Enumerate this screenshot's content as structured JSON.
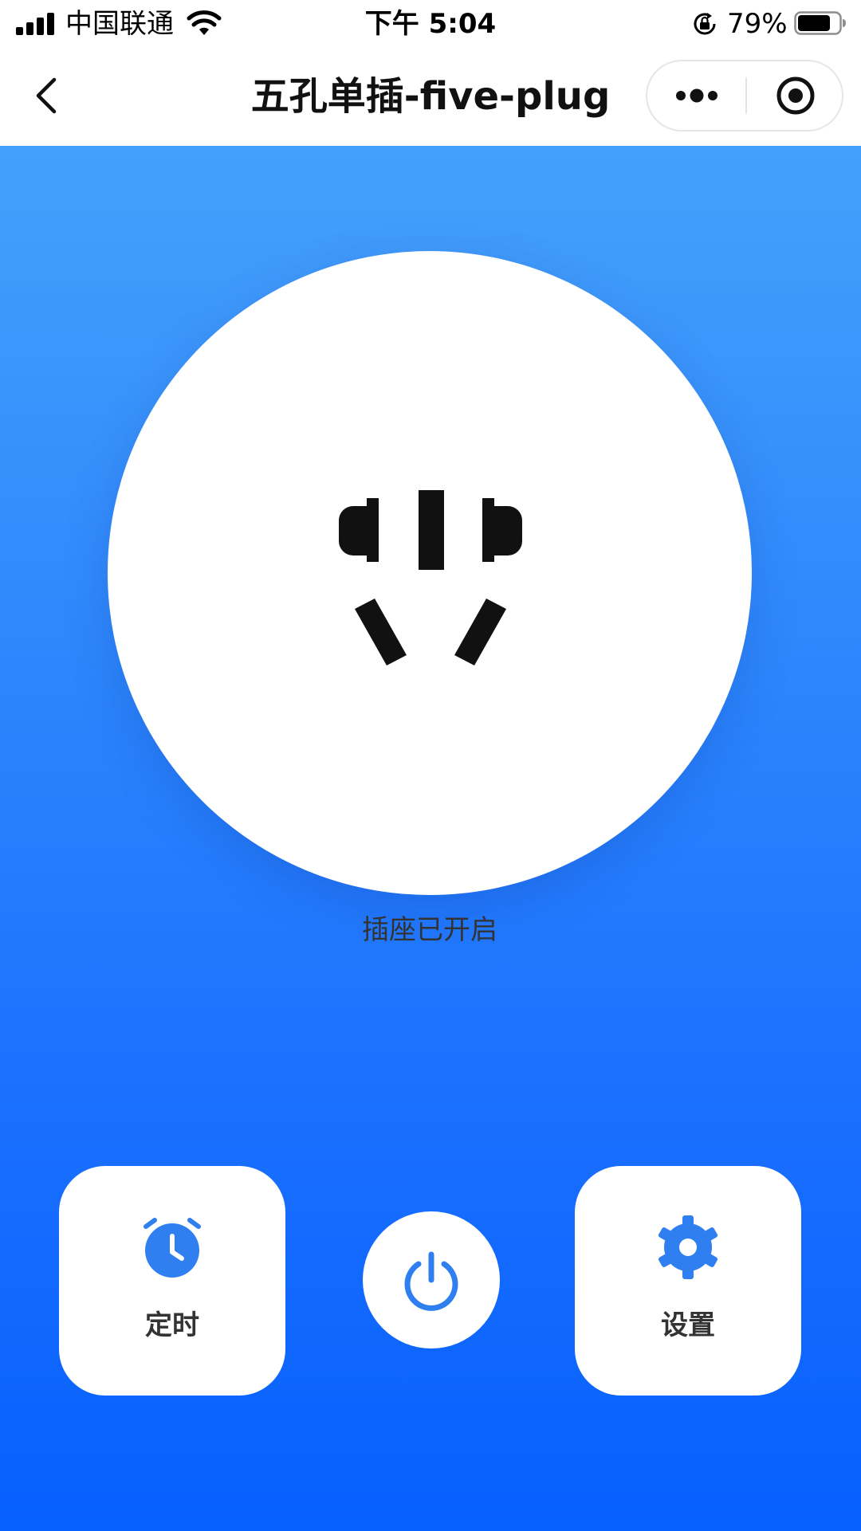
{
  "status_bar": {
    "carrier": "中国联通",
    "time": "下午 5:04",
    "battery_percent": "79%",
    "battery_level": 0.79,
    "icons": [
      "signal-icon",
      "wifi-icon",
      "rotation-lock-icon",
      "battery-icon"
    ]
  },
  "nav": {
    "title": "五孔单插-five-plug",
    "back_icon": "chevron-left-icon",
    "more_icon": "more-dots-icon",
    "close_icon": "target-close-icon"
  },
  "socket": {
    "status_text": "插座已开启",
    "icon": "five-hole-socket-icon"
  },
  "actions": {
    "timer_label": "定时",
    "timer_icon": "alarm-clock-icon",
    "power_icon": "power-icon",
    "settings_label": "设置",
    "settings_icon": "gear-icon"
  },
  "colors": {
    "gradient_top": "#45a0fb",
    "gradient_bottom": "#0660fe",
    "accent_icon": "#2f7ff0",
    "socket_holes": "#111111"
  }
}
